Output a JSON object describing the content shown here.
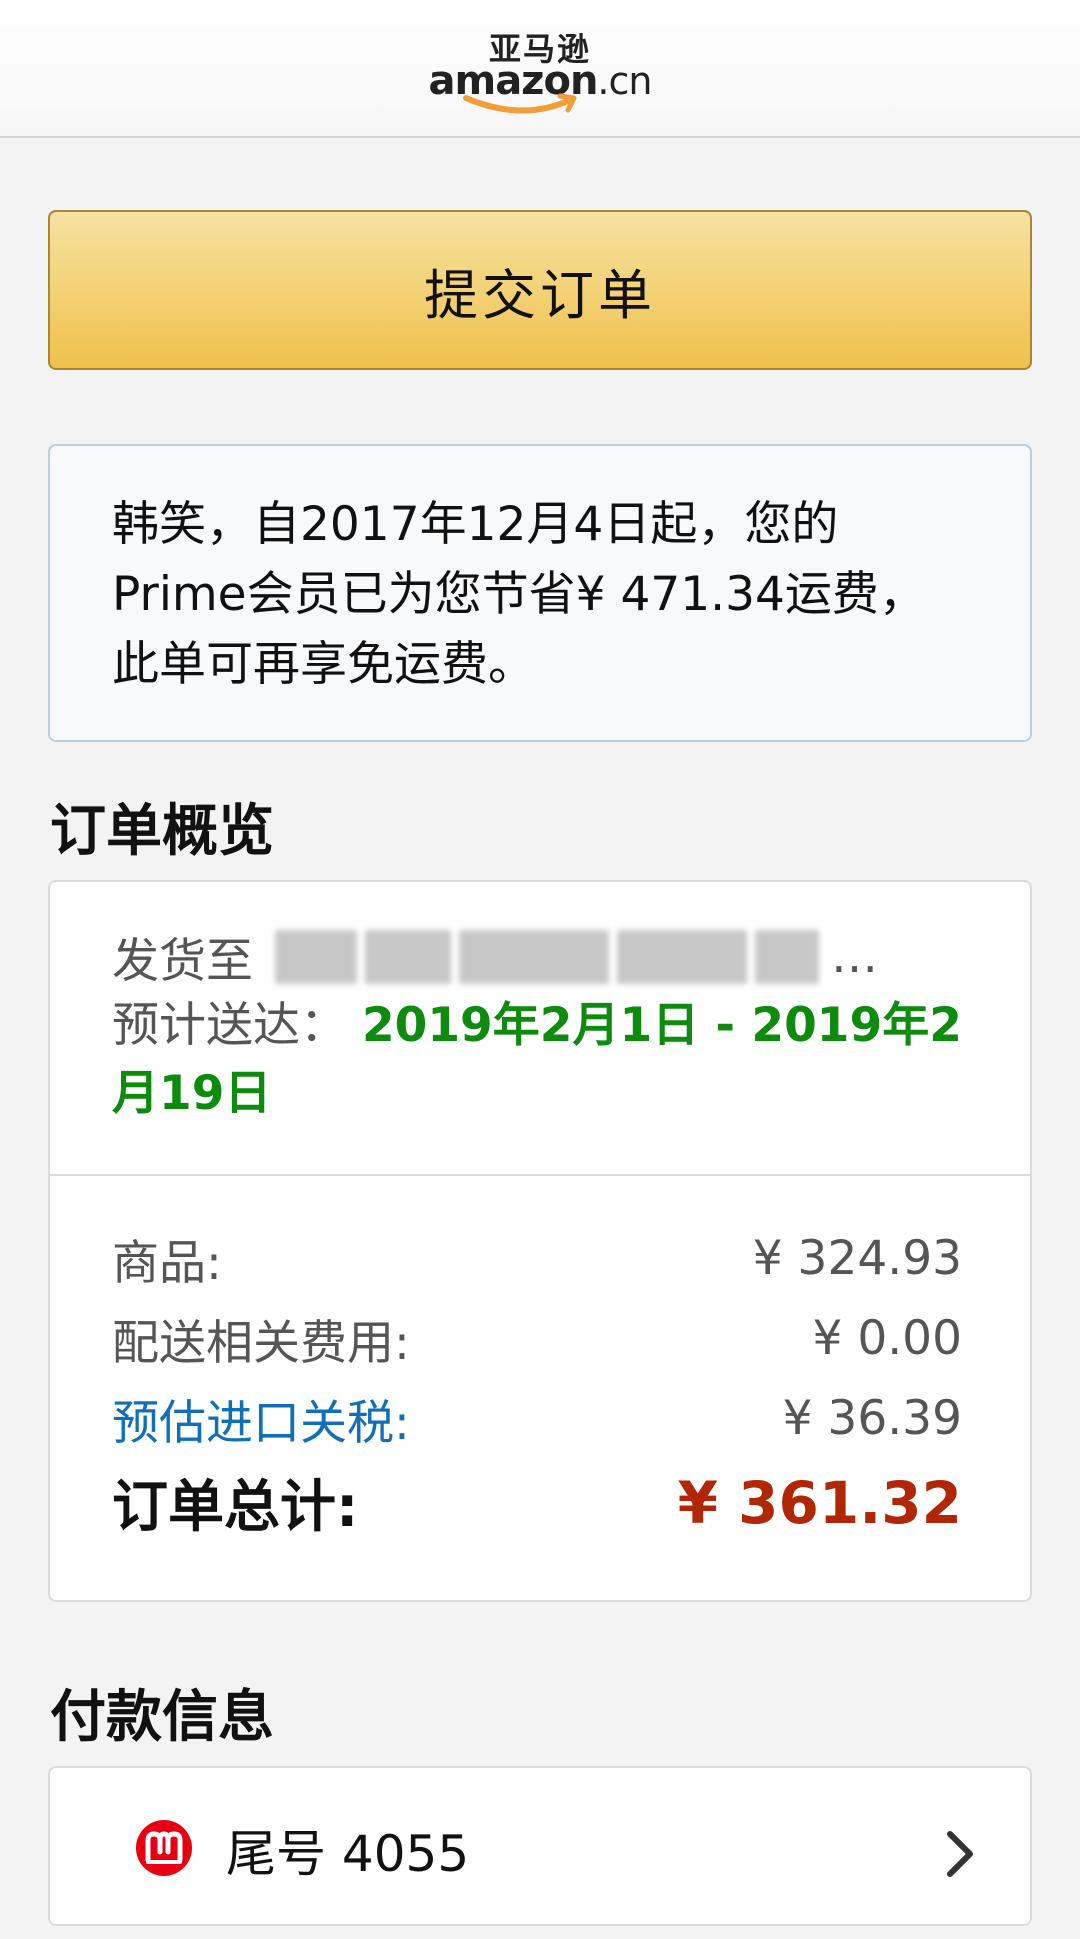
{
  "header": {
    "logo_cn": "亚马逊",
    "logo_en": "amazon",
    "logo_suffix": ".cn"
  },
  "submit_button": {
    "label": "提交订单"
  },
  "prime_notice": {
    "text": "韩笑，自2017年12月4日起，您的Prime会员已为您节省¥ 471.34运费，此单可再享免运费。"
  },
  "order_overview": {
    "title": "订单概览",
    "ship_to_label": "发货至",
    "ship_to_ellipsis": "…",
    "delivery_label": "预计送达：",
    "delivery_date": "2019年2月1日 - 2019年2月19日",
    "rows": [
      {
        "label": "商品:",
        "value": "¥ 324.93",
        "link": false
      },
      {
        "label": "配送相关费用:",
        "value": "¥ 0.00",
        "link": false
      },
      {
        "label": "预估进口关税:",
        "value": "¥ 36.39",
        "link": true
      }
    ],
    "total_label": "订单总计:",
    "total_value": "¥ 361.32"
  },
  "payment": {
    "title": "付款信息",
    "card_label": "尾号 4055",
    "bank_icon": "cmb-bank-logo-icon",
    "chevron_icon": "chevron-right-icon"
  },
  "colors": {
    "accent_green": "#0c8b0c",
    "link_blue": "#0f6fb8",
    "total_red": "#b12704",
    "button_yellow": "#f0c14b"
  }
}
